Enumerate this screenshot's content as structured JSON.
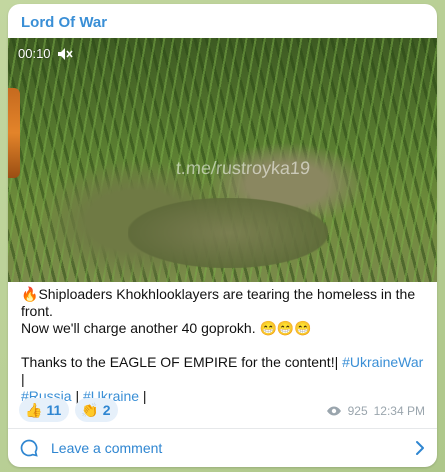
{
  "post": {
    "channel_name": "Lord Of War",
    "video": {
      "duration": "00:10",
      "watermark": "t.me/rustroyka19"
    },
    "text": {
      "line1_emoji": "🔥",
      "line1": "Shiploaders Khokhlooklayers are tearing the homeless in the front.",
      "line2": "Now we'll charge another 40 goprokh.",
      "line2_emojis": "😁😁😁",
      "line3_prefix": "Thanks to the EAGLE OF EMPIRE for the content!| ",
      "tags": [
        "#UkraineWar",
        "#Russia",
        "#Ukraine"
      ],
      "separator": " | ",
      "trailing": " |"
    },
    "reactions": [
      {
        "emoji": "👍",
        "count": "11"
      },
      {
        "emoji": "👏",
        "count": "2"
      }
    ],
    "views": "925",
    "time": "12:34 PM",
    "comment_label": "Leave a comment"
  },
  "colors": {
    "accent": "#3a8fd6",
    "reaction_bg": "#e6f0fa",
    "meta_gray": "#9aa5ad",
    "background": "#b9cf97"
  }
}
